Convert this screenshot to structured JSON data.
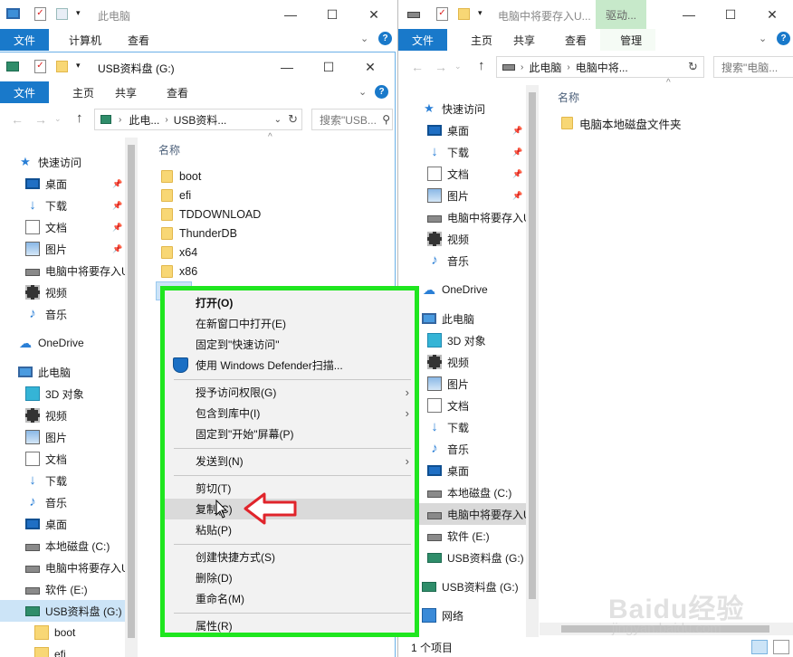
{
  "right_window": {
    "title": "电脑中将要存入U...",
    "context_tab": "驱动...",
    "tabs": [
      "文件",
      "主页",
      "共享",
      "查看",
      "管理"
    ],
    "address": "电脑中将...",
    "search_placeholder": "搜索\"电脑...",
    "column_header": "名称",
    "files": [
      "电脑本地磁盘文件夹"
    ],
    "nav": {
      "quick_access": "快速访问",
      "quick_items": [
        "桌面",
        "下载",
        "文档",
        "图片",
        "电脑中将要存入U"
      ],
      "extra_items": [
        "视频",
        "音乐"
      ],
      "onedrive": "OneDrive",
      "this_pc": "此电脑",
      "pc_items": [
        "3D 对象",
        "视频",
        "图片",
        "文档",
        "下载",
        "音乐",
        "桌面",
        "本地磁盘 (C:)",
        "电脑中将要存入U",
        "软件 (E:)",
        "USB资料盘 (G:)"
      ],
      "usb": "USB资料盘 (G:)",
      "network": "网络"
    },
    "status": "1 个项目"
  },
  "back_window": {
    "title": "此电脑",
    "tabs": [
      "文件",
      "计算机",
      "查看"
    ]
  },
  "left_window": {
    "title": "USB资料盘 (G:)",
    "tabs": [
      "文件",
      "主页",
      "共享",
      "查看"
    ],
    "address_parts": [
      "此电...",
      "USB资料..."
    ],
    "search_placeholder": "搜索\"USB...",
    "column_header": "名称",
    "files": [
      "boot",
      "efi",
      "TDDOWNLOAD",
      "ThunderDB",
      "x64",
      "x86"
    ],
    "nav": {
      "quick_access": "快速访问",
      "quick_items": [
        "桌面",
        "下载",
        "文档",
        "图片",
        "电脑中将要存入U"
      ],
      "extra_items": [
        "视频",
        "音乐"
      ],
      "onedrive": "OneDrive",
      "this_pc": "此电脑",
      "pc_items": [
        "3D 对象",
        "视频",
        "图片",
        "文档",
        "下载",
        "音乐",
        "桌面",
        "本地磁盘 (C:)",
        "电脑中将要存入U",
        "软件 (E:)",
        "USB资料盘 (G:)"
      ],
      "usb_children": [
        "boot",
        "efi"
      ]
    }
  },
  "context_menu": {
    "open": "打开(O)",
    "open_new_window": "在新窗口中打开(E)",
    "pin_quick": "固定到\"快速访问\"",
    "defender": "使用 Windows Defender扫描...",
    "grant_access": "授予访问权限(G)",
    "include_library": "包含到库中(I)",
    "pin_start": "固定到\"开始\"屏幕(P)",
    "send_to": "发送到(N)",
    "cut": "剪切(T)",
    "copy": "复制(C)",
    "paste": "粘贴(P)",
    "create_shortcut": "创建快捷方式(S)",
    "delete": "删除(D)",
    "rename": "重命名(M)",
    "properties": "属性(R)"
  },
  "watermark": {
    "brand": "Baidu经验",
    "url": "jingyan.baidu.com"
  },
  "colors": {
    "ribbon_file_tab": "#1979ca",
    "menu_border": "#1fe61f",
    "arrow": "#e0242b",
    "menu_bg": "#f2f2f2"
  }
}
